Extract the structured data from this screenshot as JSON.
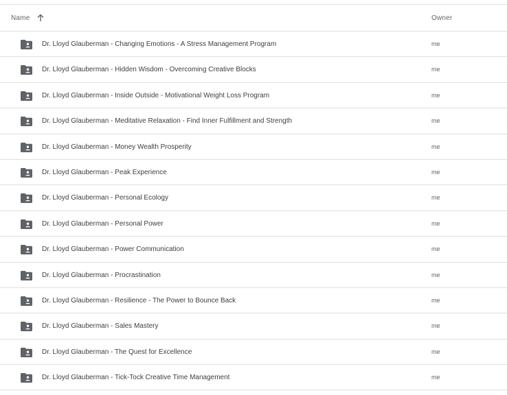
{
  "header": {
    "name_label": "Name",
    "owner_label": "Owner",
    "sort_direction": "ascending"
  },
  "colors": {
    "folder_icon": "#5f6368",
    "divider": "#e0e0e0",
    "header_text": "#5f6368",
    "item_text": "#3c4043"
  },
  "rows": [
    {
      "name": "Dr. Lloyd Glauberman - Changing Emotions - A Stress Management Program",
      "owner": "me",
      "icon": "shared-folder-icon"
    },
    {
      "name": "Dr. Lloyd Glauberman - Hidden Wisdom - Overcoming Creative Blocks",
      "owner": "me",
      "icon": "shared-folder-icon"
    },
    {
      "name": "Dr. Lloyd Glauberman - Inside Outside - Motivational Weight Loss Program",
      "owner": "me",
      "icon": "shared-folder-icon"
    },
    {
      "name": "Dr. Lloyd Glauberman - Meditative Relaxation - Find Inner Fulfillment and Strength",
      "owner": "me",
      "icon": "shared-folder-icon"
    },
    {
      "name": "Dr. Lloyd Glauberman - Money Wealth Prosperity",
      "owner": "me",
      "icon": "shared-folder-icon"
    },
    {
      "name": "Dr. Lloyd Glauberman - Peak Experience",
      "owner": "me",
      "icon": "shared-folder-icon"
    },
    {
      "name": "Dr. Lloyd Glauberman - Personal Ecology",
      "owner": "me",
      "icon": "shared-folder-icon"
    },
    {
      "name": "Dr. Lloyd Glauberman - Personal Power",
      "owner": "me",
      "icon": "shared-folder-icon"
    },
    {
      "name": "Dr. Lloyd Glauberman - Power Communication",
      "owner": "me",
      "icon": "shared-folder-icon"
    },
    {
      "name": "Dr. Lloyd Glauberman - Procrastination",
      "owner": "me",
      "icon": "shared-folder-icon"
    },
    {
      "name": "Dr. Lloyd Glauberman - Resilience - The Power to Bounce Back",
      "owner": "me",
      "icon": "shared-folder-icon"
    },
    {
      "name": "Dr. Lloyd Glauberman - Sales Mastery",
      "owner": "me",
      "icon": "shared-folder-icon"
    },
    {
      "name": "Dr. Lloyd Glauberman - The Quest for Excellence",
      "owner": "me",
      "icon": "shared-folder-icon"
    },
    {
      "name": "Dr. Lloyd Glauberman - Tick-Tock Creative Time Management",
      "owner": "me",
      "icon": "shared-folder-icon"
    }
  ]
}
